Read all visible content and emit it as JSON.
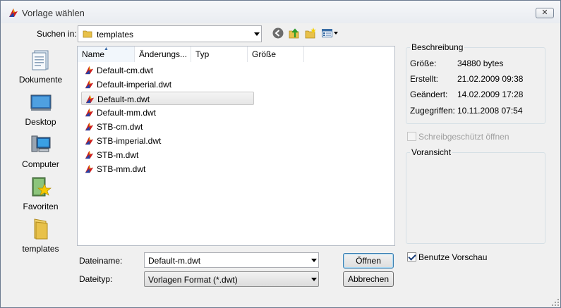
{
  "window": {
    "title": "Vorlage wählen",
    "close_label": "✕"
  },
  "lookin": {
    "label": "Suchen in:",
    "value": "templates"
  },
  "toolbar": {
    "back_icon": "back-icon",
    "up_icon": "up-folder-icon",
    "new_folder_icon": "new-folder-icon",
    "views_icon": "views-menu-icon"
  },
  "places": [
    {
      "label": "Dokumente",
      "icon": "documents-icon"
    },
    {
      "label": "Desktop",
      "icon": "desktop-icon"
    },
    {
      "label": "Computer",
      "icon": "computer-icon"
    },
    {
      "label": "Favoriten",
      "icon": "favorites-icon"
    },
    {
      "label": "templates",
      "icon": "folder-icon"
    }
  ],
  "columns": [
    "Name",
    "Änderungs...",
    "Typ",
    "Größe"
  ],
  "files": [
    {
      "name": "Default-cm.dwt",
      "selected": false
    },
    {
      "name": "Default-imperial.dwt",
      "selected": false
    },
    {
      "name": "Default-m.dwt",
      "selected": true
    },
    {
      "name": "Default-mm.dwt",
      "selected": false
    },
    {
      "name": "STB-cm.dwt",
      "selected": false
    },
    {
      "name": "STB-imperial.dwt",
      "selected": false
    },
    {
      "name": "STB-m.dwt",
      "selected": false
    },
    {
      "name": "STB-mm.dwt",
      "selected": false
    }
  ],
  "filename": {
    "label": "Dateiname:",
    "value": "Default-m.dwt"
  },
  "filetype": {
    "label": "Dateityp:",
    "value": "Vorlagen Format (*.dwt)"
  },
  "buttons": {
    "open": "Öffnen",
    "cancel": "Abbrechen"
  },
  "description": {
    "title": "Beschreibung",
    "rows": [
      {
        "label": "Größe:",
        "value": "34880 bytes"
      },
      {
        "label": "Erstellt:",
        "value": "21.02.2009 09:38"
      },
      {
        "label": "Geändert:",
        "value": "14.02.2009 17:28"
      },
      {
        "label": "Zugegriffen:",
        "value": "10.11.2008 07:54"
      }
    ]
  },
  "readonly": {
    "label": "Schreibgeschützt öffnen",
    "checked": false,
    "enabled": false
  },
  "preview": {
    "title": "Voransicht"
  },
  "use_preview": {
    "label": "Benutze Vorschau",
    "checked": true
  },
  "colors": {
    "accent": "#3c7fb1",
    "selection": "#e6e6e6"
  }
}
